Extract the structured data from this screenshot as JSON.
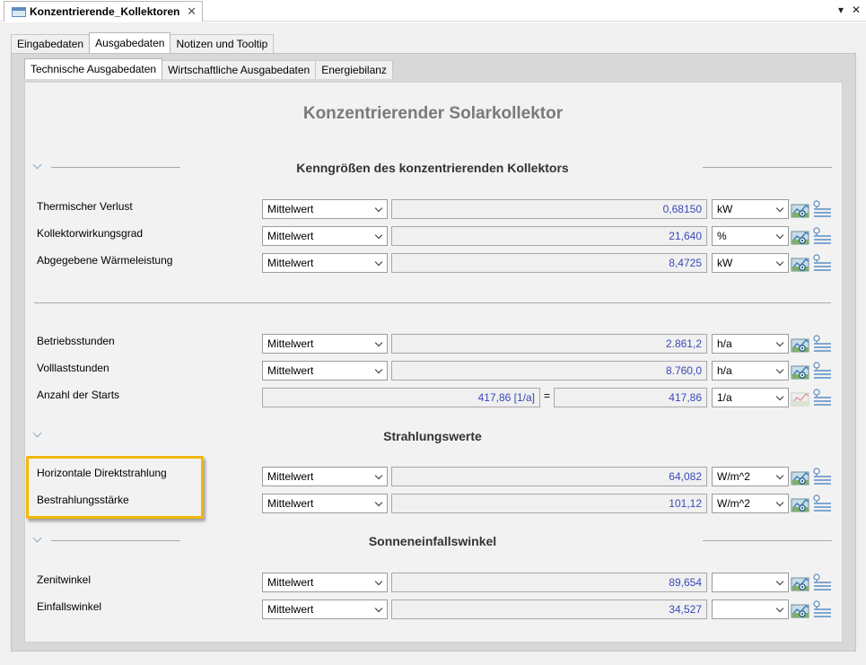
{
  "doc_tab": {
    "title": "Konzentrierende_Kollektoren",
    "close": "✕"
  },
  "window_controls": {
    "menu": "▾",
    "close": "✕"
  },
  "outer_tabs": [
    {
      "label": "Eingabedaten"
    },
    {
      "label": "Ausgabedaten"
    },
    {
      "label": "Notizen und Tooltip"
    }
  ],
  "inner_tabs": [
    {
      "label": "Technische Ausgabedaten"
    },
    {
      "label": "Wirtschaftliche Ausgabedaten"
    },
    {
      "label": "Energiebilanz"
    }
  ],
  "page_title": "Konzentrierender Solarkollektor",
  "sections": {
    "kenngroessen": "Kenngrößen des konzentrierenden Kollektors",
    "strahlung": "Strahlungswerte",
    "sonne": "Sonneneinfallswinkel"
  },
  "rows": {
    "thermischer_verlust": {
      "label": "Thermischer Verlust",
      "mode": "Mittelwert",
      "value": "0,68150",
      "unit": "kW"
    },
    "kollektorwirkungsgrad": {
      "label": "Kollektorwirkungsgrad",
      "mode": "Mittelwert",
      "value": "21,640",
      "unit": "%"
    },
    "waermeleistung": {
      "label": "Abgegebene Wärmeleistung",
      "mode": "Mittelwert",
      "value": "8,4725",
      "unit": "kW"
    },
    "betriebsstunden": {
      "label": "Betriebsstunden",
      "mode": "Mittelwert",
      "value": "2.861,2",
      "unit": "h/a"
    },
    "volllaststunden": {
      "label": "Volllaststunden",
      "mode": "Mittelwert",
      "value": "8.760,0",
      "unit": "h/a"
    },
    "starts": {
      "label": "Anzahl der Starts",
      "formula": "417,86 [1/a]",
      "equals": "=",
      "value": "417,86",
      "unit": "1/a"
    },
    "direktstrahlung": {
      "label": "Horizontale Direktstrahlung",
      "mode": "Mittelwert",
      "value": "64,082",
      "unit": "W/m^2"
    },
    "bestrahlung": {
      "label": "Bestrahlungsstärke",
      "mode": "Mittelwert",
      "value": "101,12",
      "unit": "W/m^2"
    },
    "zenitwinkel": {
      "label": "Zenitwinkel",
      "mode": "Mittelwert",
      "value": "89,654",
      "unit": ""
    },
    "einfallswinkel": {
      "label": "Einfallswinkel",
      "mode": "Mittelwert",
      "value": "34,527",
      "unit": ""
    }
  },
  "colors": {
    "value_text": "#3a49b8",
    "highlight": "#f2b705"
  }
}
